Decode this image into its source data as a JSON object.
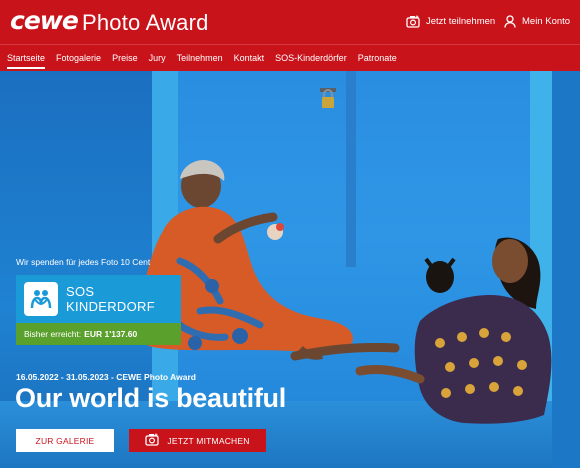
{
  "header": {
    "logo_text": "cewe",
    "title": "Photo Award",
    "actions": [
      {
        "label": "Jetzt teilnehmen",
        "icon": "camera-plus-icon"
      },
      {
        "label": "Mein Konto",
        "icon": "user-icon"
      }
    ]
  },
  "nav": {
    "items": [
      {
        "label": "Startseite",
        "active": true
      },
      {
        "label": "Fotogalerie"
      },
      {
        "label": "Preise"
      },
      {
        "label": "Jury"
      },
      {
        "label": "Teilnehmen"
      },
      {
        "label": "Kontakt"
      },
      {
        "label": "SOS-Kinderdörfer"
      },
      {
        "label": "Patronate"
      }
    ]
  },
  "hero": {
    "donate_text": "Wir spenden für jedes Foto 10 Cent",
    "sos": {
      "line1": "SOS",
      "line2": "KINDERDORF"
    },
    "progress_label": "Bisher erreicht:",
    "progress_value": "EUR 1'137.60",
    "dates": "16.05.2022 - 31.05.2023 - CEWE Photo Award",
    "headline": "Our world is beautiful",
    "gallery_button": "ZUR GALERIE",
    "join_button": "JETZT MITMACHEN"
  },
  "colors": {
    "brand_red": "#c8131b",
    "sos_blue": "#1a9ad7",
    "progress_green": "#5aa02c"
  }
}
